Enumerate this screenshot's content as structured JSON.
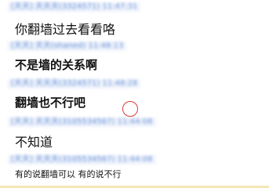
{
  "messages": [
    {
      "header": "[天天] 天天天(3324571) 11:47:31",
      "text": "你翻墙过去看看咯"
    },
    {
      "header": "[天天] 天天(shaned) 11:48:13",
      "text": "不是墙的关系啊"
    },
    {
      "header": "[天天] 天天天(3324571) 11:48:28",
      "text": "翻墙也不行吧"
    },
    {
      "header": "[天天] 天天天(3105534567) 11:44:08",
      "text": "不知道"
    },
    {
      "header": "[天天] 天天天(3105534567) 11:44:08",
      "text": "有的说翻墙可以 有的说不行"
    }
  ],
  "colors": {
    "meta": "#4f7fd0",
    "message": "#111111",
    "cursor_ring": "#e03a3a",
    "bottom_edge": "#f4e7b4"
  }
}
